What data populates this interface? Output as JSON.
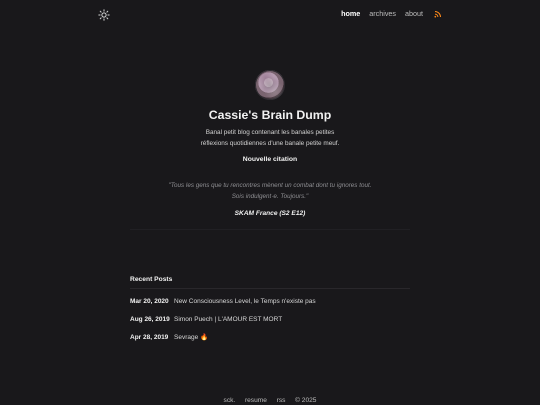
{
  "nav": {
    "theme_icon": "sun-icon",
    "items": [
      {
        "label": "home"
      },
      {
        "label": "archives"
      },
      {
        "label": "about"
      }
    ],
    "rss_icon": "rss-icon"
  },
  "profile": {
    "avatar_icon": "avatar",
    "title": "Cassie's Brain Dump",
    "bio_line_1": "Banal petit blog contenant les banales petites",
    "bio_line_2": "réflexions quotidiennes d'une banale petite meuf."
  },
  "quote": {
    "title": "Nouvelle citation",
    "line_1": "\"Tous les gens que tu rencontres mènent un combat dont tu ignores tout.",
    "line_2": "Sois indulgent·e. Toujours.\"",
    "source": "SKAM France (S2 E12)"
  },
  "recent_posts": {
    "title": "Recent Posts",
    "items": [
      {
        "date": "Mar 20, 2020",
        "title": "New Consciousness Level, le Temps n'existe pas"
      },
      {
        "date": "Aug 26, 2019",
        "title": "Simon Puech | L'AMOUR EST MORT"
      },
      {
        "date": "Apr 28, 2019",
        "title": "Sevrage 🔥"
      }
    ]
  },
  "footer": {
    "link_1": "sck.",
    "link_2": "resume",
    "link_3": "rss",
    "copyright": "© 2025"
  },
  "colors": {
    "background": "#19181b",
    "text": "#e6e6e6",
    "muted": "#8f8f93",
    "rss": "#ff8a1a"
  }
}
